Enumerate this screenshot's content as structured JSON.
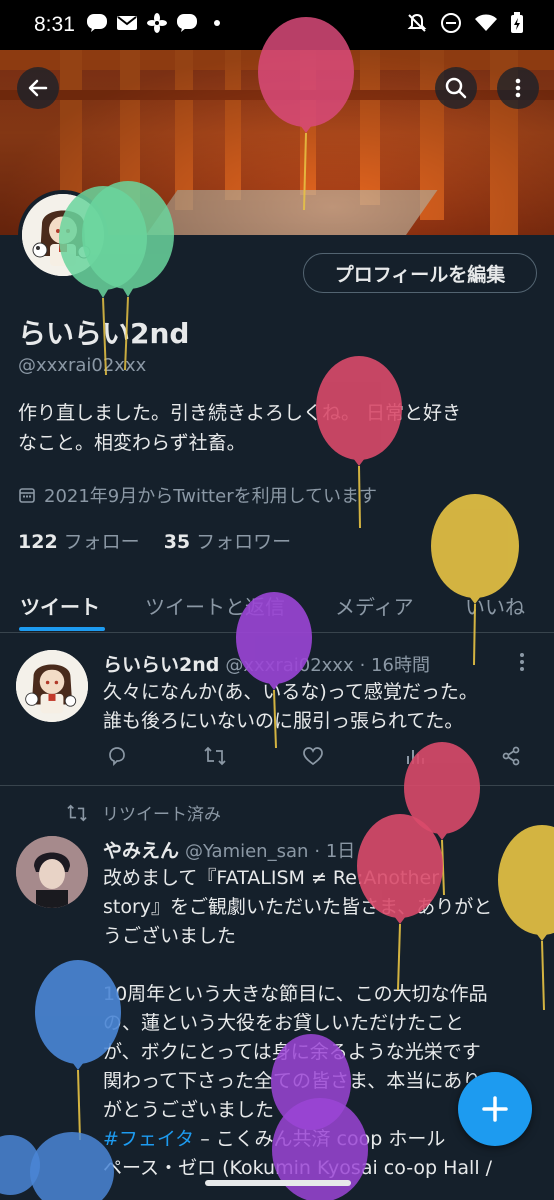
{
  "status_bar": {
    "time": "8:31",
    "notification_icons": [
      "line-icon",
      "mail-icon",
      "pinwheel-icon",
      "line-icon",
      "dot-icon"
    ],
    "system_icons": [
      "mute-icon",
      "do-not-disturb-icon",
      "wifi-icon",
      "battery-icon"
    ],
    "line_label": "LINE"
  },
  "header": {
    "back_icon": "arrow-left-icon",
    "search_icon": "search-icon",
    "more_icon": "more-vertical-icon"
  },
  "profile": {
    "edit_button": "プロフィールを編集",
    "name": "らいらい2nd",
    "handle": "@xxxrai02xxx",
    "bio_line1": "作り直しました。引き続きよろしくね。 日常と好き",
    "bio_line2": "なこと。相変わらず社畜。",
    "joined": "2021年9月からTwitterを利用しています",
    "following_count": "122",
    "following_label": "フォロー",
    "followers_count": "35",
    "followers_label": "フォロワー"
  },
  "tabs": [
    {
      "label": "ツイート",
      "active": true
    },
    {
      "label": "ツイートと返信",
      "active": false
    },
    {
      "label": "メディア",
      "active": false
    },
    {
      "label": "いいね",
      "active": false
    }
  ],
  "tweets": [
    {
      "name": "らいらい2nd",
      "handle": "@xxxrai02xxx",
      "time": "· 16時間",
      "line1": "久々になんか(あ、いるな)って感覚だった。",
      "line2": "誰も後ろにいないのに服引っ張られてた。"
    },
    {
      "retweet_label": "リツイート済み",
      "name": "やみえん",
      "handle": "@Yamien_san",
      "time": "· 1日",
      "line1": "改めまして『FATALISM ≠ Re:Another",
      "line2": "story』をご観劇いただいた皆さま、ありがと",
      "line3": "うございました",
      "line4": "10周年という大きな節目に、この大切な作品",
      "line5": "の、蓮という大役をお貸しいただけたこと",
      "line6": "が、ボクにとっては身に余るような光栄です",
      "line7": "関わって下さった全ての皆さま、本当にあり",
      "line8": "がとうございました",
      "line9_hashtag": "#フェイタ",
      "line9_rest": " – こくみん共済 coop ホール",
      "line10": "ペース・ゼロ (Kokumin Kyosai co-op Hall /"
    }
  ],
  "fab_icon": "plus-icon",
  "colors": {
    "background": "#15202b",
    "accent": "#1d9bf0",
    "text": "#e7e9ea",
    "secondary_text": "#8b98a5",
    "divider": "#38444d"
  },
  "balloon_colors": [
    "#6ad59e",
    "#d94a6a",
    "#e8c444",
    "#9b45d6",
    "#4a86d6"
  ]
}
